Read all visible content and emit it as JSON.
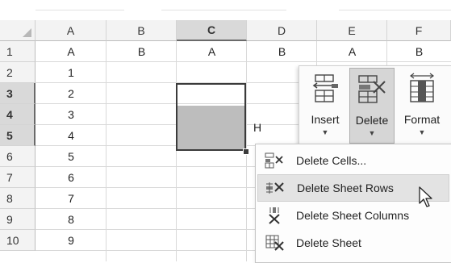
{
  "spreadsheet": {
    "column_headers": [
      "A",
      "B",
      "C",
      "D",
      "E",
      "F"
    ],
    "selected_column": "C",
    "row_headers": [
      "1",
      "2",
      "3",
      "4",
      "5",
      "6",
      "7",
      "8",
      "9",
      "10"
    ],
    "selected_rows": [
      "3",
      "4",
      "5"
    ],
    "row1_values": {
      "A": "A",
      "B": "B",
      "C": "A",
      "D": "B",
      "E": "A",
      "F": "B"
    },
    "column_a_values": [
      "1",
      "2",
      "3",
      "4",
      "5",
      "6",
      "7",
      "8",
      "9"
    ],
    "partial_cell_text": "H"
  },
  "ribbon": {
    "buttons": [
      {
        "label": "Insert",
        "icon": "insert-cells-icon",
        "active": false
      },
      {
        "label": "Delete",
        "icon": "delete-cells-icon",
        "active": true
      },
      {
        "label": "Format",
        "icon": "format-cells-icon",
        "active": false
      }
    ]
  },
  "delete_menu": {
    "items": [
      {
        "label": "Delete Cells...",
        "icon": "delete-cells-icon",
        "hovered": false
      },
      {
        "label": "Delete Sheet Rows",
        "icon": "delete-rows-icon",
        "hovered": true
      },
      {
        "label": "Delete Sheet Columns",
        "icon": "delete-columns-icon",
        "hovered": false
      },
      {
        "label": "Delete Sheet",
        "icon": "delete-sheet-icon",
        "hovered": false
      }
    ]
  },
  "colors": {
    "selection_border": "#3b3b3b",
    "selection_fill": "#bdbdbd",
    "header_selected": "#d9d9d9",
    "menu_hover": "#e3e3e3"
  }
}
